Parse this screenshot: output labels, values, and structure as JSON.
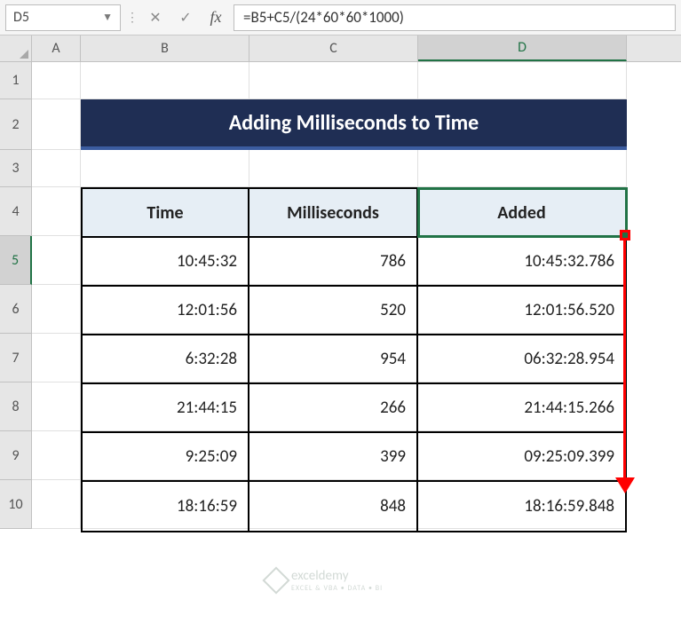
{
  "name_box": "D5",
  "formula": "=B5+C5/(24*60*60*1000)",
  "columns": [
    "A",
    "B",
    "C",
    "D"
  ],
  "rows": [
    "1",
    "2",
    "3",
    "4",
    "5",
    "6",
    "7",
    "8",
    "9",
    "10"
  ],
  "active_col": "D",
  "active_row": "5",
  "title": "Adding Milliseconds to Time",
  "headers": {
    "time": "Time",
    "ms": "Milliseconds",
    "added": "Added"
  },
  "data": [
    {
      "time": "10:45:32",
      "ms": "786",
      "added": "10:45:32.786"
    },
    {
      "time": "12:01:56",
      "ms": "520",
      "added": "12:01:56.520"
    },
    {
      "time": "6:32:28",
      "ms": "954",
      "added": "06:32:28.954"
    },
    {
      "time": "21:44:15",
      "ms": "266",
      "added": "21:44:15.266"
    },
    {
      "time": "9:25:09",
      "ms": "399",
      "added": "09:25:09.399"
    },
    {
      "time": "18:16:59",
      "ms": "848",
      "added": "18:16:59.848"
    }
  ],
  "watermark": {
    "brand": "exceldemy",
    "tag": "EXCEL & VBA • DATA • BI"
  },
  "chart_data": {
    "type": "table",
    "title": "Adding Milliseconds to Time",
    "columns": [
      "Time",
      "Milliseconds",
      "Added"
    ],
    "rows": [
      [
        "10:45:32",
        786,
        "10:45:32.786"
      ],
      [
        "12:01:56",
        520,
        "12:01:56.520"
      ],
      [
        "6:32:28",
        954,
        "06:32:28.954"
      ],
      [
        "21:44:15",
        266,
        "21:44:15.266"
      ],
      [
        "9:25:09",
        399,
        "09:25:09.399"
      ],
      [
        "18:16:59",
        848,
        "18:16:59.848"
      ]
    ]
  }
}
